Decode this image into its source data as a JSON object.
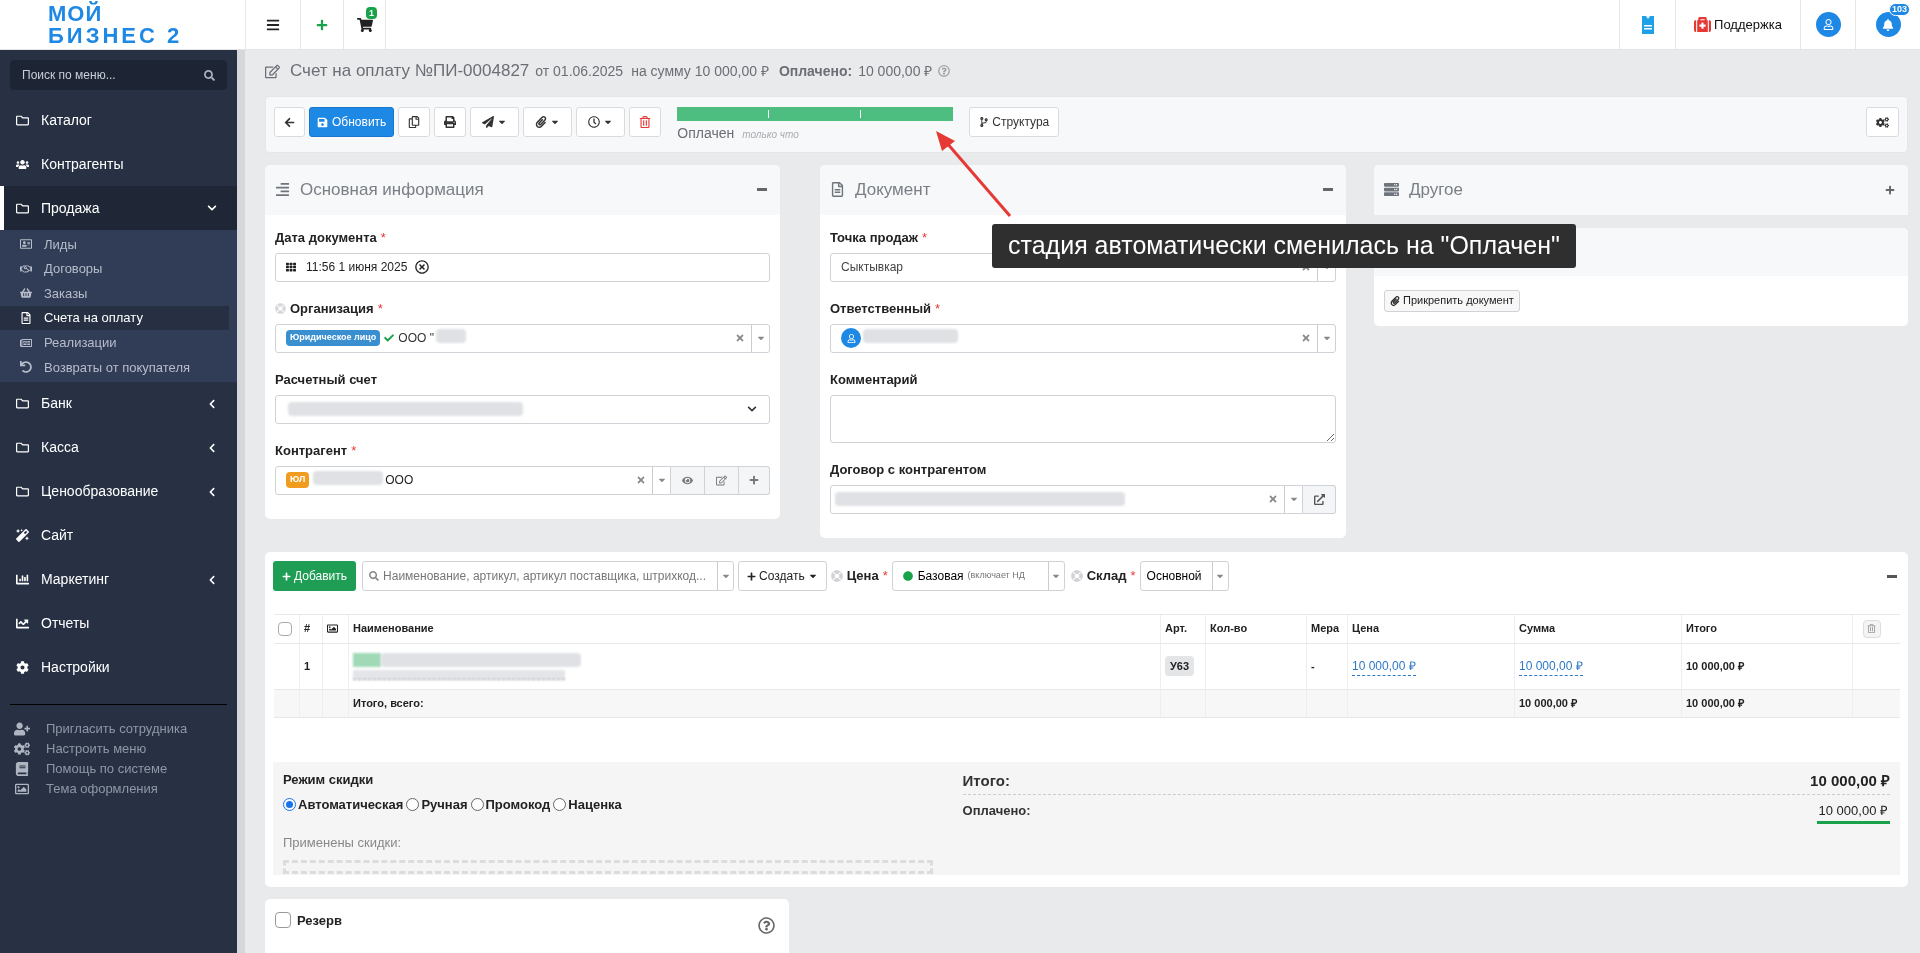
{
  "logo": {
    "line1": "МОЙ",
    "line2": "БИЗНЕС 2"
  },
  "topbar": {
    "cart_badge": "1",
    "support": "Поддержка",
    "notifications_badge": "103"
  },
  "sidebar": {
    "search_placeholder": "Поиск по меню...",
    "items": [
      {
        "kind": "link",
        "label": "Каталог"
      },
      {
        "kind": "link",
        "label": "Контрагенты"
      },
      {
        "kind": "group",
        "label": "Продажа",
        "expanded": true,
        "children": [
          {
            "label": "Лиды",
            "selected": false
          },
          {
            "label": "Договоры",
            "selected": false
          },
          {
            "label": "Заказы",
            "selected": false
          },
          {
            "label": "Счета на оплату",
            "selected": true
          },
          {
            "label": "Реализации",
            "selected": false
          },
          {
            "label": "Возвраты от покупателя",
            "selected": false
          }
        ]
      },
      {
        "kind": "group",
        "label": "Банк",
        "expanded": false
      },
      {
        "kind": "group",
        "label": "Касса",
        "expanded": false
      },
      {
        "kind": "group",
        "label": "Ценообразование",
        "expanded": false
      },
      {
        "kind": "link",
        "label": "Сайт"
      },
      {
        "kind": "group",
        "label": "Маркетинг",
        "expanded": false
      },
      {
        "kind": "link",
        "label": "Отчеты"
      },
      {
        "kind": "link",
        "label": "Настройки"
      }
    ],
    "footer_links": [
      "Пригласить сотрудника",
      "Настроить меню",
      "Помощь по системе",
      "Тема оформления"
    ]
  },
  "header": {
    "title": "Счет на оплату №ПИ-0004827",
    "date": "от 01.06.2025",
    "amount": "на сумму 10 000,00 ₽",
    "paid_label": "Оплачено:",
    "paid_value": "10 000,00 ₽"
  },
  "toolbar": {
    "save_label": "Обновить",
    "stage": {
      "level": 1,
      "label": "Оплачен",
      "time": "только что"
    },
    "structure_label": "Структура"
  },
  "panels": [
    {
      "title": "Основная информация",
      "collapsed": false,
      "fields": [
        {
          "kind": "date",
          "label": "Дата документа",
          "required_mark": "*",
          "value": "11:56 1 июня 2025"
        },
        {
          "kind": "org",
          "label": "Организация",
          "required_mark": "*",
          "tag": "Юридическое лицо",
          "value": "ООО \""
        },
        {
          "kind": "select",
          "label": "Расчетный счет"
        },
        {
          "kind": "contractor",
          "label": "Контрагент",
          "required_mark": "*",
          "tag": "ЮЛ",
          "value": "ООО"
        }
      ]
    },
    {
      "title": "Документ",
      "collapsed": false,
      "fields": [
        {
          "kind": "combo",
          "label": "Точка продаж",
          "required_mark": "*",
          "value": "Сыктывкар"
        },
        {
          "kind": "person",
          "label": "Ответственный",
          "required_mark": "*"
        },
        {
          "kind": "textarea",
          "label": "Комментарий"
        },
        {
          "kind": "contract",
          "label": "Договор с контрагентом"
        }
      ]
    },
    {
      "title": "Другое",
      "collapsed": true
    }
  ],
  "linked_documents": {
    "attach_label": "Прикрепить документ"
  },
  "products": {
    "add_label": "Добавить",
    "search_placeholder": "Наименование, артикул, артикул поставщика, штрихкод...",
    "create_label": "Создать",
    "price_label": "Цена",
    "price_required_mark": "*",
    "warehouse_required_mark": "*",
    "select_all_checked": false,
    "price_value": "Базовая",
    "price_note": "(включает НД",
    "warehouse_label": "Склад",
    "warehouse_value": "Основной",
    "columns": [
      "#",
      "Наименование",
      "Арт.",
      "Кол-во",
      "Мера",
      "Цена",
      "Сумма",
      "Итого"
    ],
    "rows": [
      {
        "number": "1",
        "article": "У63",
        "unit": "-",
        "price": "10 000,00 ₽",
        "sum": "10 000,00 ₽",
        "total": "10 000,00 ₽"
      }
    ],
    "totals": {
      "label": "Итого, всего:",
      "sum": "10 000,00 ₽",
      "total": "10 000,00 ₽"
    }
  },
  "discount": {
    "title": "Режим скидки",
    "modes": [
      {
        "label": "Автоматическая",
        "selected": true
      },
      {
        "label": "Ручная",
        "selected": false
      },
      {
        "label": "Промокод",
        "selected": false
      },
      {
        "label": "Наценка",
        "selected": false
      }
    ],
    "applied_label": "Применены скидки:"
  },
  "summary": {
    "total_label": "Итого:",
    "total_value": "10 000,00 ₽",
    "paid_label": "Оплачено:",
    "paid_value": "10 000,00 ₽"
  },
  "reserve": {
    "label": "Резерв",
    "checked": false
  },
  "annotation": {
    "text": "стадия автоматически сменилась на \"Оплачен\""
  }
}
